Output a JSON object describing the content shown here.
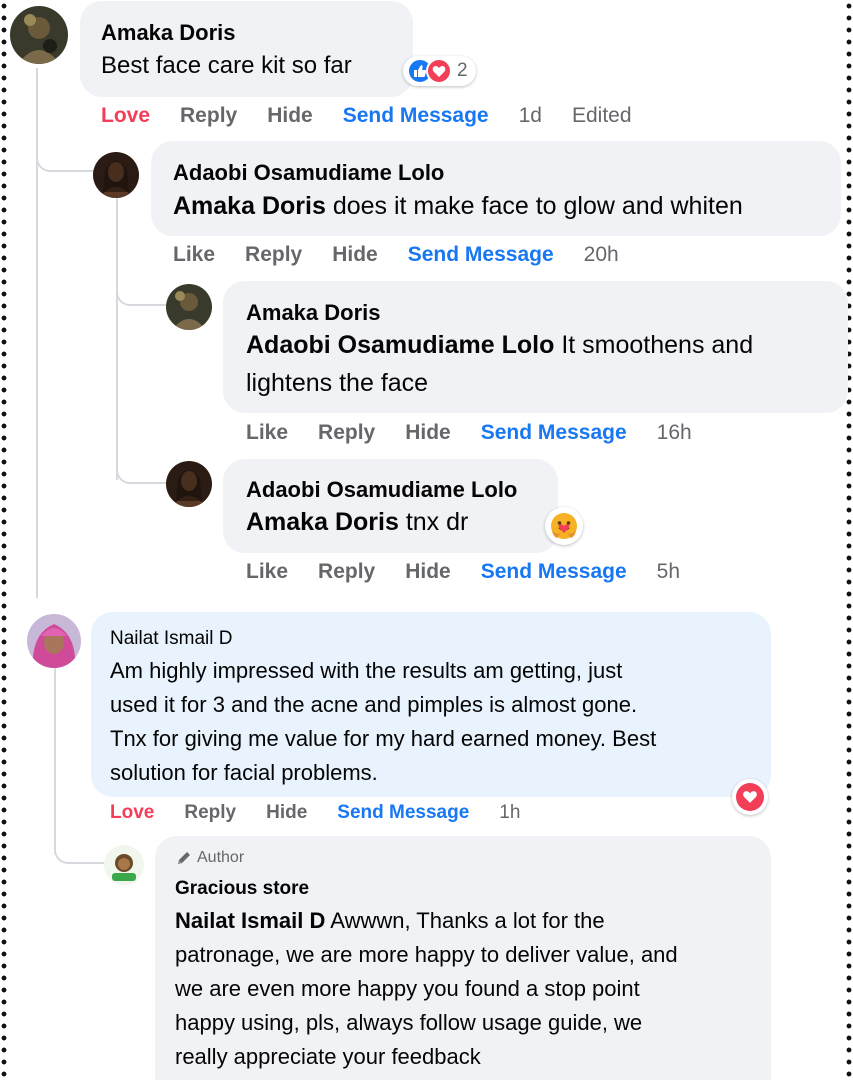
{
  "comments": [
    {
      "author": "Amaka Doris",
      "text": "Best face care kit so far",
      "reactions": {
        "count": "2",
        "types": [
          "like-icon",
          "love-icon"
        ]
      },
      "actions": {
        "react": "Love",
        "reply": "Reply",
        "hide": "Hide",
        "send": "Send Message",
        "time": "1d",
        "edited": "Edited"
      }
    },
    {
      "author": "Adaobi Osamudiame Lolo",
      "mention": "Amaka Doris",
      "text": "does it make face to glow and whiten",
      "actions": {
        "react": "Like",
        "reply": "Reply",
        "hide": "Hide",
        "send": "Send Message",
        "time": "20h"
      }
    },
    {
      "author": "Amaka Doris",
      "mention": "Adaobi Osamudiame Lolo",
      "text_line1": "It smoothens and",
      "text_line2": "lightens the face",
      "actions": {
        "react": "Like",
        "reply": "Reply",
        "hide": "Hide",
        "send": "Send Message",
        "time": "16h"
      }
    },
    {
      "author": "Adaobi Osamudiame Lolo",
      "mention": "Amaka Doris",
      "text": "tnx dr",
      "reaction_emoji": "care-emoji-icon",
      "actions": {
        "react": "Like",
        "reply": "Reply",
        "hide": "Hide",
        "send": "Send Message",
        "time": "5h"
      }
    },
    {
      "author": "Nailat Ismail D",
      "lines": [
        "Am highly impressed with the results am getting, just",
        "used it for 3 and the acne and pimples is almost gone.",
        "Tnx for giving me value for my hard earned money. Best",
        "solution for facial problems."
      ],
      "reaction_emoji": "love-icon",
      "actions": {
        "react": "Love",
        "reply": "Reply",
        "hide": "Hide",
        "send": "Send Message",
        "time": "1h"
      }
    },
    {
      "badge": "Author",
      "author": "Gracious store",
      "mention": "Nailat Ismail D",
      "line1_rest": "Awwwn, Thanks a lot for the",
      "lines": [
        "patronage, we are more happy to deliver value, and",
        "we are even more happy you found a stop point",
        "happy using, pls, always follow usage guide, we",
        "really appreciate your feedback"
      ]
    }
  ],
  "colors": {
    "love": "#f33e58",
    "link": "#1877f2",
    "muted": "#65676b",
    "bubble": "#f0f2f5",
    "highlight": "#e8f3fd"
  }
}
